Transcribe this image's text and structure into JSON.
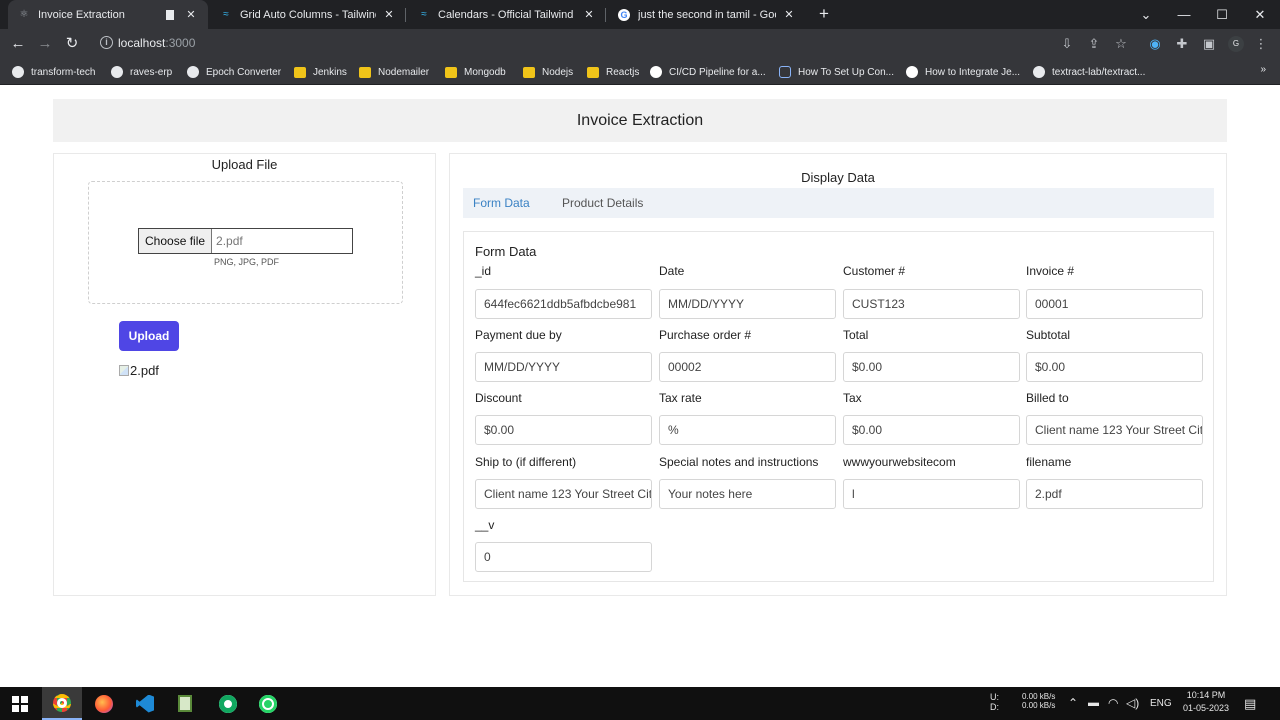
{
  "browser": {
    "tabs": [
      {
        "title": "Invoice Extraction",
        "active": true
      },
      {
        "title": "Grid Auto Columns - Tailwind CSS",
        "active": false
      },
      {
        "title": "Calendars - Official Tailwind CSS",
        "active": false
      },
      {
        "title": "just the second in tamil - Google",
        "active": false
      }
    ],
    "url_host": "localhost",
    "url_port": ":3000",
    "profile_initial": "G",
    "bookmarks": [
      "transform-tech",
      "raves-erp",
      "Epoch Converter",
      "Jenkins",
      "Nodemailer",
      "Mongodb",
      "Nodejs",
      "Reactjs",
      "CI/CD Pipeline for a...",
      "How To Set Up Con...",
      "How to Integrate Je...",
      "textract-lab/textract..."
    ],
    "bookmarks_more": "»"
  },
  "page": {
    "header": "Invoice Extraction",
    "upload": {
      "title": "Upload File",
      "choose_label": "Choose file",
      "file_name": "2.pdf",
      "hint": "PNG, JPG, PDF",
      "button": "Upload",
      "preview_alt": "2.pdf"
    },
    "display": {
      "title": "Display Data",
      "tabs": [
        "Form Data",
        "Product Details"
      ],
      "form_heading": "Form Data",
      "fields": [
        {
          "label": "_id",
          "value": "644fec6621ddb5afbdcbe981"
        },
        {
          "label": "Date",
          "value": "MM/DD/YYYY"
        },
        {
          "label": "Customer #",
          "value": "CUST123"
        },
        {
          "label": "Invoice #",
          "value": "00001"
        },
        {
          "label": "Payment due by",
          "value": "MM/DD/YYYY"
        },
        {
          "label": "Purchase order #",
          "value": "00002"
        },
        {
          "label": "Total",
          "value": "$0.00"
        },
        {
          "label": "Subtotal",
          "value": "$0.00"
        },
        {
          "label": "Discount",
          "value": "$0.00"
        },
        {
          "label": "Tax rate",
          "value": "%"
        },
        {
          "label": "Tax",
          "value": "$0.00"
        },
        {
          "label": "Billed to",
          "value": "Client name 123 Your Street Cit"
        },
        {
          "label": "Ship to (if different)",
          "value": "Client name 123 Your Street Cit"
        },
        {
          "label": "Special notes and instructions",
          "value": "Your notes here"
        },
        {
          "label": "wwwyourwebsitecom",
          "value": "l"
        },
        {
          "label": "filename",
          "value": "2.pdf"
        },
        {
          "label": "__v",
          "value": "0"
        }
      ]
    }
  },
  "taskbar": {
    "net_up_label": "U:",
    "net_down_label": "D:",
    "net_up": "0.00 kB/s",
    "net_down": "0.00 kB/s",
    "language": "ENG",
    "time": "10:14 PM",
    "date": "01-05-2023"
  }
}
